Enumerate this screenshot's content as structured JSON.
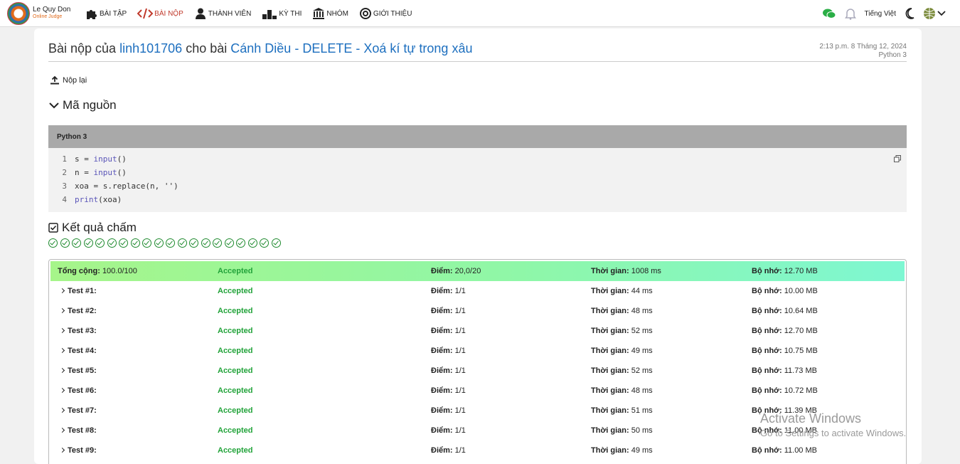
{
  "nav": {
    "logo_line1": "Le Quy Don",
    "logo_line2": "Online Judge",
    "items": [
      {
        "label": "BÀI TẬP",
        "icon": "puzzle-icon",
        "active": false
      },
      {
        "label": "BÀI NỘP",
        "icon": "code-icon",
        "active": true
      },
      {
        "label": "THÀNH VIÊN",
        "icon": "user-icon",
        "active": false
      },
      {
        "label": "KỲ THI",
        "icon": "podium-icon",
        "active": false
      },
      {
        "label": "NHÓM",
        "icon": "institution-icon",
        "active": false
      },
      {
        "label": "GIỚI THIỆU",
        "icon": "at-icon",
        "active": false
      }
    ],
    "language": "Tiếng Việt"
  },
  "submission": {
    "prefix": "Bài nộp của",
    "user": "linh101706",
    "middle": "cho bài",
    "problem": "Cánh Diều - DELETE - Xoá kí tự trong xâu",
    "datetime": "2:13 p.m. 8 Tháng 12, 2024",
    "language": "Python 3",
    "resubmit": "Nộp lại"
  },
  "source": {
    "heading": "Mã nguồn",
    "lang_header": "Python 3",
    "lines": [
      {
        "n": "1",
        "code": "s = input()"
      },
      {
        "n": "2",
        "code": "n = input()"
      },
      {
        "n": "3",
        "code": "xoa = s.replace(n, '')"
      },
      {
        "n": "4",
        "code": "print(xoa)"
      }
    ]
  },
  "result": {
    "heading": "Kết quả chấm",
    "check_count": 20,
    "total": {
      "label": "Tổng cộng:",
      "score_pct": "100.0/100",
      "status": "Accepted",
      "points_label": "Điểm:",
      "points": "20,0/20",
      "time_label": "Thời gian:",
      "time": "1008 ms",
      "mem_label": "Bộ nhớ:",
      "mem": "12.70 MB"
    },
    "tests": [
      {
        "name": "Test #1:",
        "status": "Accepted",
        "points": "1/1",
        "time": "44 ms",
        "mem": "10.00 MB"
      },
      {
        "name": "Test #2:",
        "status": "Accepted",
        "points": "1/1",
        "time": "48 ms",
        "mem": "10.64 MB"
      },
      {
        "name": "Test #3:",
        "status": "Accepted",
        "points": "1/1",
        "time": "52 ms",
        "mem": "12.70 MB"
      },
      {
        "name": "Test #4:",
        "status": "Accepted",
        "points": "1/1",
        "time": "49 ms",
        "mem": "10.75 MB"
      },
      {
        "name": "Test #5:",
        "status": "Accepted",
        "points": "1/1",
        "time": "52 ms",
        "mem": "11.73 MB"
      },
      {
        "name": "Test #6:",
        "status": "Accepted",
        "points": "1/1",
        "time": "48 ms",
        "mem": "10.72 MB"
      },
      {
        "name": "Test #7:",
        "status": "Accepted",
        "points": "1/1",
        "time": "51 ms",
        "mem": "11.39 MB"
      },
      {
        "name": "Test #8:",
        "status": "Accepted",
        "points": "1/1",
        "time": "50 ms",
        "mem": "11.00 MB"
      },
      {
        "name": "Test #9:",
        "status": "Accepted",
        "points": "1/1",
        "time": "49 ms",
        "mem": "11.00 MB"
      }
    ]
  },
  "watermark": {
    "line1": "Activate Windows",
    "line2": "Go to Settings to activate Windows."
  },
  "colors": {
    "link": "#1d6fbf",
    "accepted": "#22a33a",
    "active_nav": "#c0392b"
  }
}
